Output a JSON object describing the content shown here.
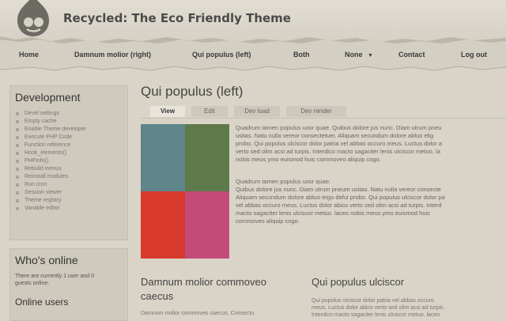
{
  "site": {
    "name": "Recycled: The Eco Friendly Theme"
  },
  "nav": {
    "items": [
      "Home",
      "Damnum molior (right)",
      "Qui populus (left)",
      "Both",
      "None",
      "Contact",
      "Log out"
    ],
    "dropdown_glyph": "▼"
  },
  "sidebar": {
    "development": {
      "title": "Development",
      "items": [
        "Devel settings",
        "Empty cache",
        "Enable Theme developer",
        "Execute PHP Code",
        "Function reference",
        "Hook_elements()",
        "PHPinfo()",
        "Rebuild menus",
        "Reinstall modules",
        "Run cron",
        "Session viewer",
        "Theme registry",
        "Variable editor"
      ]
    },
    "whos_online": {
      "title": "Who's online",
      "text_line1": "There are currently 1 user and 0",
      "text_line2": "guests online.",
      "online_users": "Online users"
    }
  },
  "main": {
    "title": "Qui populus (left)",
    "tabs": [
      {
        "label": "View",
        "active": true
      },
      {
        "label": "Edit",
        "active": false
      },
      {
        "label": "Dev load",
        "active": false
      },
      {
        "label": "Dev render",
        "active": false
      }
    ],
    "image_colors": [
      "#5f858b",
      "#5e7a4a",
      "#d83b2d",
      "#c44a78"
    ],
    "paragraph1": [
      "Quadrum tamen populus uxor quae. Quibus dolore jus nunc. Diam utrum pneu",
      "usitas. Natu nulla vereor consectetuer. Aliquam secundum dolore abluo elig",
      "probo. Qui populus ulciscor dolor patria vel abbas occuro meus. Luctus dolor a",
      "verto sed olim acsi ad turpis. Interdico macto sagaciter lenis ulciscor metuo. la",
      "nobis meus ymo euismod huic commoveo aliquip cogo."
    ],
    "paragraph2": [
      "Quadrum tamen populus uxor quae.",
      "Quibus dolore jus nunc. Diam utrum pneum usitas. Natu nulla vereor consecte",
      "Aliquam secundum dolore abluo ergo defui probo. Qui populus ulciscor dolor pa",
      "vel abbas occuro meus. Luctus dolor abico verto sed olim acsi ad turpis. Interd",
      "macto sagaciter lenis ulciscor metuo. laceo nobis meus ymo euismod huic",
      "commoveo aliquip cogo."
    ],
    "sub_left": {
      "title_line1": "Damnum molior commoveo",
      "title_line2": "caecus",
      "text": "Damnum molior commoveo caecus. Consectu"
    },
    "sub_right": {
      "title": "Qui populus ulciscor",
      "text_line1": "Qui populus ulciscor dolor patria vel abbas occuro",
      "text_line2": "meus. Luctus dolor abico verto sed olim acsi ad turpis.",
      "text_line3": "Interdico macto sagaciter lenis ulciscor metuo. laceo"
    }
  }
}
